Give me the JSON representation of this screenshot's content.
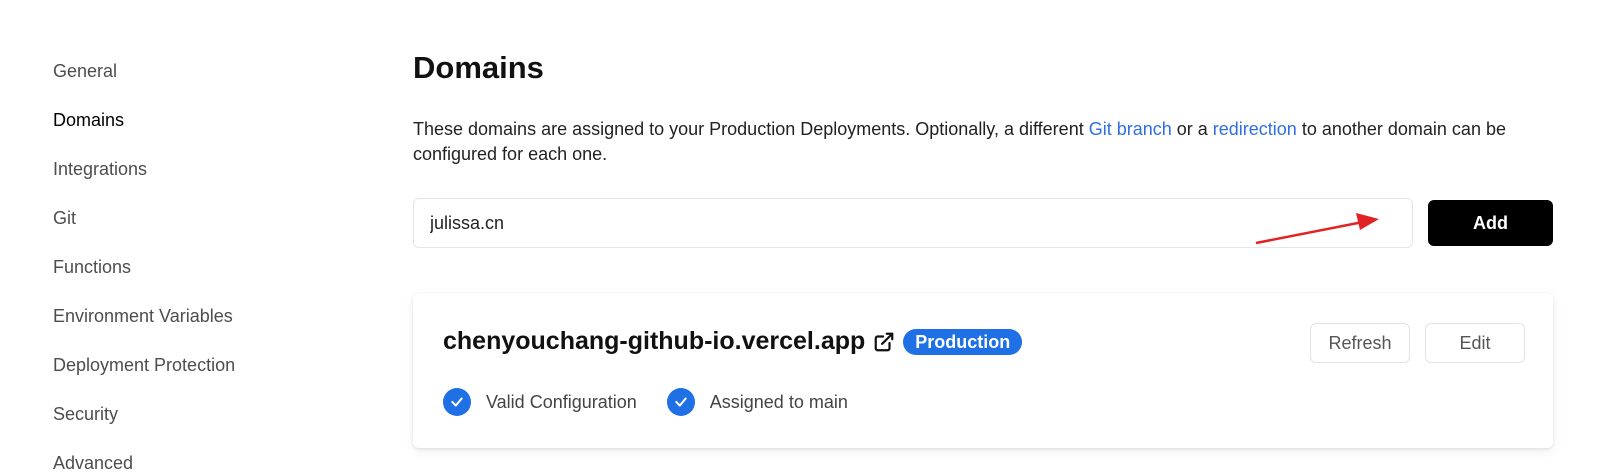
{
  "sidebar": {
    "items": [
      {
        "label": "General",
        "active": false
      },
      {
        "label": "Domains",
        "active": true
      },
      {
        "label": "Integrations",
        "active": false
      },
      {
        "label": "Git",
        "active": false
      },
      {
        "label": "Functions",
        "active": false
      },
      {
        "label": "Environment Variables",
        "active": false
      },
      {
        "label": "Deployment Protection",
        "active": false
      },
      {
        "label": "Security",
        "active": false
      },
      {
        "label": "Advanced",
        "active": false
      }
    ]
  },
  "main": {
    "title": "Domains",
    "description": {
      "part1": "These domains are assigned to your Production Deployments. Optionally, a different ",
      "link1": "Git branch",
      "part2": " or a ",
      "link2": "redirection",
      "part3": " to another domain can be configured for each one."
    },
    "domain_input": {
      "value": "julissa.cn",
      "placeholder": ""
    },
    "add_label": "Add"
  },
  "domain_card": {
    "domain": "chenyouchang-github-io.vercel.app",
    "badge": "Production",
    "refresh_label": "Refresh",
    "edit_label": "Edit",
    "statuses": [
      {
        "label": "Valid Configuration"
      },
      {
        "label": "Assigned to main"
      }
    ]
  },
  "colors": {
    "accent": "#1f6fe5",
    "link": "#2f6fe0",
    "annotation_arrow": "#e02424"
  }
}
